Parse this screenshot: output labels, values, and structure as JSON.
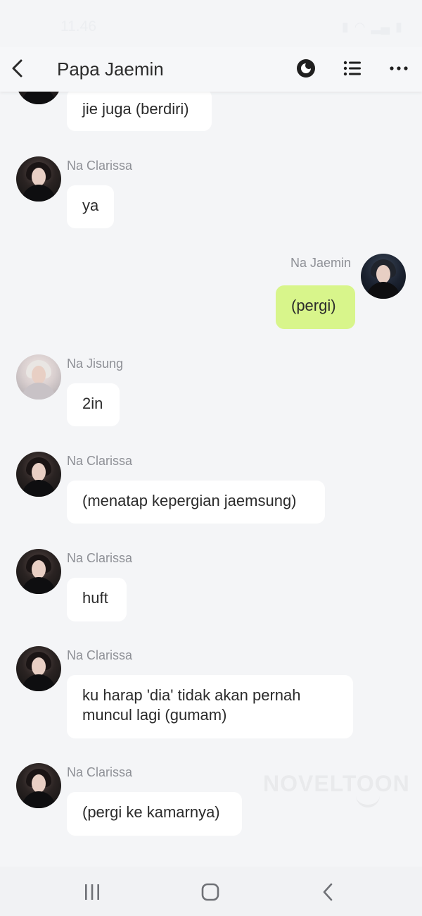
{
  "status": {
    "time": "11.46"
  },
  "header": {
    "title": "Papa Jaemin"
  },
  "chat": {
    "top_partial": {
      "text": "jie juga (berdiri)"
    },
    "messages": [
      {
        "sender": "Na Clarissa",
        "text": "ya"
      },
      {
        "sender": "Na Jaemin",
        "text": "(pergi)"
      },
      {
        "sender": "Na Jisung",
        "text": "2in"
      },
      {
        "sender": "Na Clarissa",
        "text": "(menatap kepergian jaemsung)"
      },
      {
        "sender": "Na Clarissa",
        "text": "huft"
      },
      {
        "sender": "Na Clarissa",
        "text": "ku harap 'dia' tidak akan pernah muncul lagi (gumam)"
      },
      {
        "sender": "Na Clarissa",
        "text": "(pergi ke kamarnya)"
      }
    ]
  },
  "watermark": {
    "text": "NOVELTOON"
  },
  "colors": {
    "my_bubble": "#d8f58b",
    "other_bubble": "#ffffff",
    "background": "#f4f5f7"
  }
}
